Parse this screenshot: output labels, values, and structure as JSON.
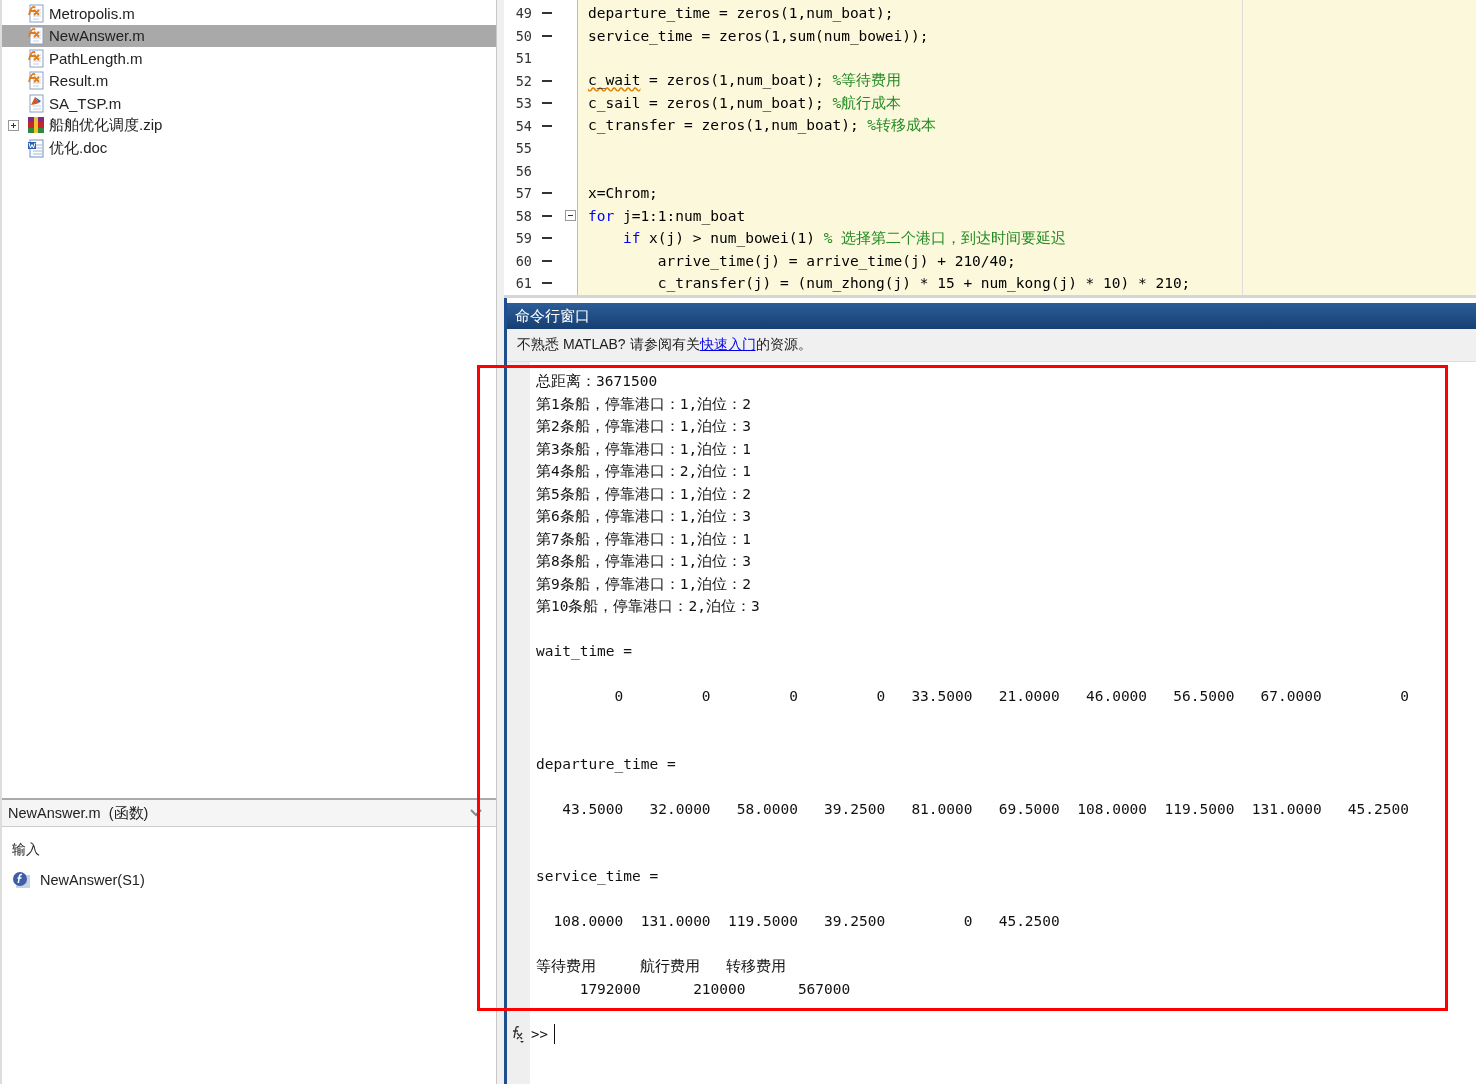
{
  "files": [
    {
      "name": "Metropolis.m",
      "kind": "function",
      "selected": false
    },
    {
      "name": "NewAnswer.m",
      "kind": "function",
      "selected": true
    },
    {
      "name": "PathLength.m",
      "kind": "function",
      "selected": false
    },
    {
      "name": "Result.m",
      "kind": "function",
      "selected": false
    },
    {
      "name": "SA_TSP.m",
      "kind": "script",
      "selected": false
    },
    {
      "name": "船舶优化调度.zip",
      "kind": "archive",
      "selected": false,
      "expanded": false
    },
    {
      "name": "优化.doc",
      "kind": "document",
      "selected": false
    }
  ],
  "details": {
    "title": "NewAnswer.m  (函数)",
    "section": "输入",
    "entries": [
      {
        "kind": "function",
        "text": "NewAnswer(S1)"
      }
    ]
  },
  "editor": {
    "lines": [
      {
        "number": "49",
        "executable": true,
        "fold": false,
        "segments": [
          {
            "kind": "code",
            "text": "departure_time = zeros(1,num_boat);"
          }
        ]
      },
      {
        "number": "50",
        "executable": true,
        "fold": false,
        "segments": [
          {
            "kind": "code",
            "text": "service_time = zeros(1,sum(num_bowei));"
          }
        ]
      },
      {
        "number": "51",
        "executable": false,
        "fold": false
      },
      {
        "number": "52",
        "executable": true,
        "fold": false,
        "segments": [
          {
            "kind": "warning",
            "text": "c_wait"
          },
          {
            "kind": "code",
            "text": " = zeros(1,num_boat); "
          },
          {
            "kind": "comment",
            "text": "%等待费用"
          }
        ]
      },
      {
        "number": "53",
        "executable": true,
        "fold": false,
        "segments": [
          {
            "kind": "code",
            "text": "c_sail = zeros(1,num_boat); "
          },
          {
            "kind": "comment",
            "text": "%航行成本"
          }
        ]
      },
      {
        "number": "54",
        "executable": true,
        "fold": false,
        "segments": [
          {
            "kind": "code",
            "text": "c_transfer = zeros(1,num_boat); "
          },
          {
            "kind": "comment",
            "text": "%转移成本"
          }
        ]
      },
      {
        "number": "55",
        "executable": false,
        "fold": false
      },
      {
        "number": "56",
        "executable": false,
        "fold": false
      },
      {
        "number": "57",
        "executable": true,
        "fold": false,
        "segments": [
          {
            "kind": "code",
            "text": "x=Chrom;"
          }
        ]
      },
      {
        "number": "58",
        "executable": true,
        "fold": true,
        "segments": [
          {
            "kind": "keyword",
            "text": "for"
          },
          {
            "kind": "code",
            "text": " j=1:1:num_boat"
          }
        ]
      },
      {
        "number": "59",
        "executable": true,
        "fold": false,
        "segments": [
          {
            "kind": "keyword",
            "text": "    if"
          },
          {
            "kind": "code",
            "text": " x(j) > num_bowei(1) "
          },
          {
            "kind": "comment",
            "text": "% 选择第二个港口，到达时间要延迟"
          }
        ]
      },
      {
        "number": "60",
        "executable": true,
        "fold": false,
        "segments": [
          {
            "kind": "code",
            "text": "        arrive_time(j) = arrive_time(j) + 210/40;"
          }
        ]
      },
      {
        "number": "61",
        "executable": true,
        "fold": false,
        "segments": [
          {
            "kind": "code",
            "text": "        c_transfer(j) = (num_zhong(j) * 15 + num_kong(j) * 10) * 210;"
          }
        ]
      }
    ]
  },
  "command_window": {
    "title": "命令行窗口",
    "notice": {
      "before": "不熟悉 MATLAB? 请参阅有关",
      "link": "快速入门",
      "after": "的资源。"
    },
    "output": [
      {
        "kind": "line",
        "text": "总距离：3671500"
      },
      {
        "kind": "line",
        "text": "第1条船，停靠港口：1,泊位：2"
      },
      {
        "kind": "line",
        "text": "第2条船，停靠港口：1,泊位：3"
      },
      {
        "kind": "line",
        "text": "第3条船，停靠港口：1,泊位：1"
      },
      {
        "kind": "line",
        "text": "第4条船，停靠港口：2,泊位：1"
      },
      {
        "kind": "line",
        "text": "第5条船，停靠港口：1,泊位：2"
      },
      {
        "kind": "line",
        "text": "第6条船，停靠港口：1,泊位：3"
      },
      {
        "kind": "line",
        "text": "第7条船，停靠港口：1,泊位：1"
      },
      {
        "kind": "line",
        "text": "第8条船，停靠港口：1,泊位：3"
      },
      {
        "kind": "line",
        "text": "第9条船，停靠港口：1,泊位：2"
      },
      {
        "kind": "line",
        "text": "第10条船，停靠港口：2,泊位：3"
      },
      {
        "kind": "blank"
      },
      {
        "kind": "line",
        "text": "wait_time ="
      },
      {
        "kind": "blank"
      },
      {
        "kind": "line",
        "text": "         0         0         0         0   33.5000   21.0000   46.0000   56.5000   67.0000         0"
      },
      {
        "kind": "blank"
      },
      {
        "kind": "blank"
      },
      {
        "kind": "line",
        "text": "departure_time ="
      },
      {
        "kind": "blank"
      },
      {
        "kind": "line",
        "text": "   43.5000   32.0000   58.0000   39.2500   81.0000   69.5000  108.0000  119.5000  131.0000   45.2500"
      },
      {
        "kind": "blank"
      },
      {
        "kind": "blank"
      },
      {
        "kind": "line",
        "text": "service_time ="
      },
      {
        "kind": "blank"
      },
      {
        "kind": "line",
        "text": "  108.0000  131.0000  119.5000   39.2500         0   45.2500"
      },
      {
        "kind": "blank"
      },
      {
        "kind": "line",
        "text": "等待费用     航行费用   转移费用"
      },
      {
        "kind": "line",
        "text": "     1792000      210000      567000"
      }
    ],
    "prompt": ">>"
  }
}
